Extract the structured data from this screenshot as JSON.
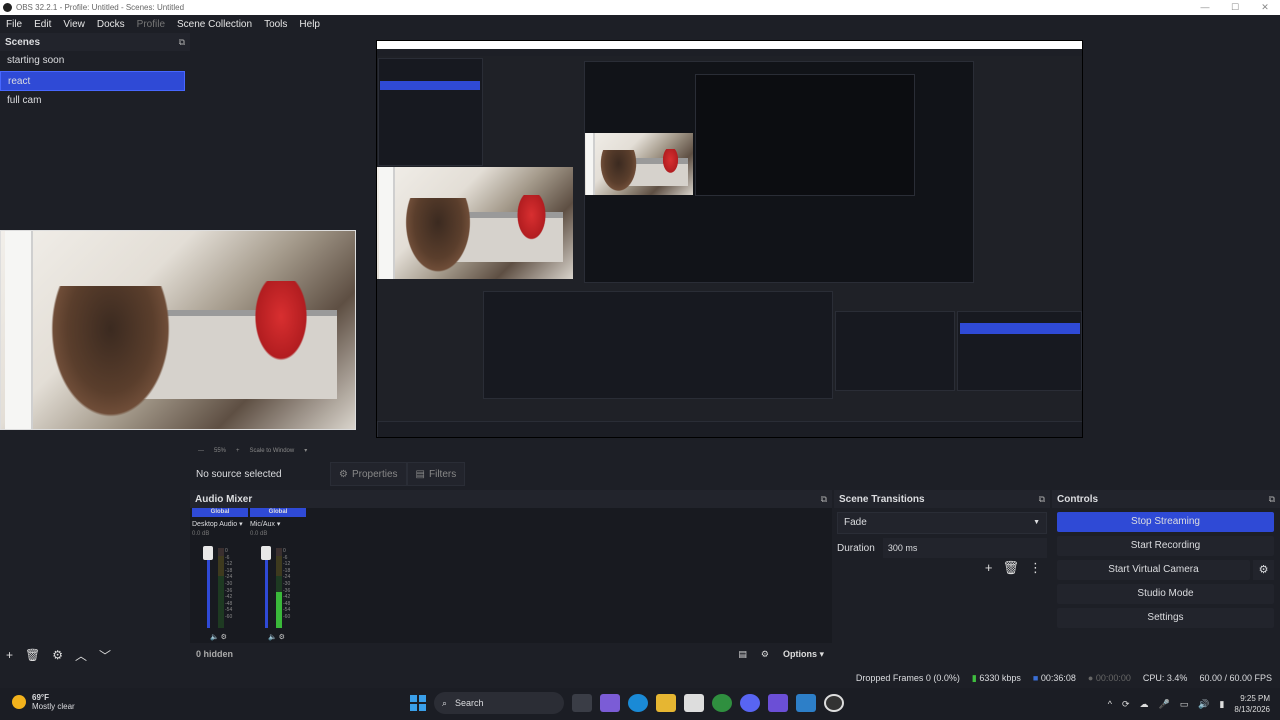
{
  "window": {
    "title": "OBS 32.2.1 - Profile: Untitled - Scenes: Untitled"
  },
  "menu": [
    "File",
    "Edit",
    "View",
    "Docks",
    "Profile",
    "Scene Collection",
    "Tools",
    "Help"
  ],
  "scenes": {
    "header": "Scenes",
    "items": [
      "starting soon",
      "react",
      "full cam"
    ],
    "selected": "react"
  },
  "preview": {
    "zoom": "55%",
    "scale_mode": "Scale to Window"
  },
  "context": {
    "no_source": "No source selected",
    "properties": "Properties",
    "filters": "Filters"
  },
  "mixer": {
    "header": "Audio Mixer",
    "channels": [
      {
        "scope": "Global",
        "name": "Desktop Audio",
        "db": "0.0 dB"
      },
      {
        "scope": "Global",
        "name": "Mic/Aux",
        "db": "0.0 dB"
      }
    ],
    "scale": [
      "0",
      "-6",
      "-12",
      "-18",
      "-24",
      "-30",
      "-36",
      "-42",
      "-48",
      "-54",
      "-60"
    ],
    "hidden": "0 hidden",
    "options": "Options"
  },
  "transitions": {
    "header": "Scene Transitions",
    "selected": "Fade",
    "duration_label": "Duration",
    "duration_value": "300 ms"
  },
  "controls": {
    "header": "Controls",
    "stop_streaming": "Stop Streaming",
    "start_recording": "Start Recording",
    "start_virtual_camera": "Start Virtual Camera",
    "studio_mode": "Studio Mode",
    "settings": "Settings"
  },
  "status": {
    "dropped": "Dropped Frames 0 (0.0%)",
    "bitrate": "6330 kbps",
    "stream_time": "00:36:08",
    "rec_time": "00:00:00",
    "cpu": "CPU: 3.4%",
    "fps": "60.00 / 60.00 FPS"
  },
  "taskbar": {
    "temp": "69°F",
    "weather": "Mostly clear",
    "search": "Search",
    "time": "9:25 PM",
    "date": "8/13/2026"
  },
  "colors": {
    "accent": "#2f4ad6",
    "bg": "#1d1f26",
    "panel": "#22242c"
  }
}
